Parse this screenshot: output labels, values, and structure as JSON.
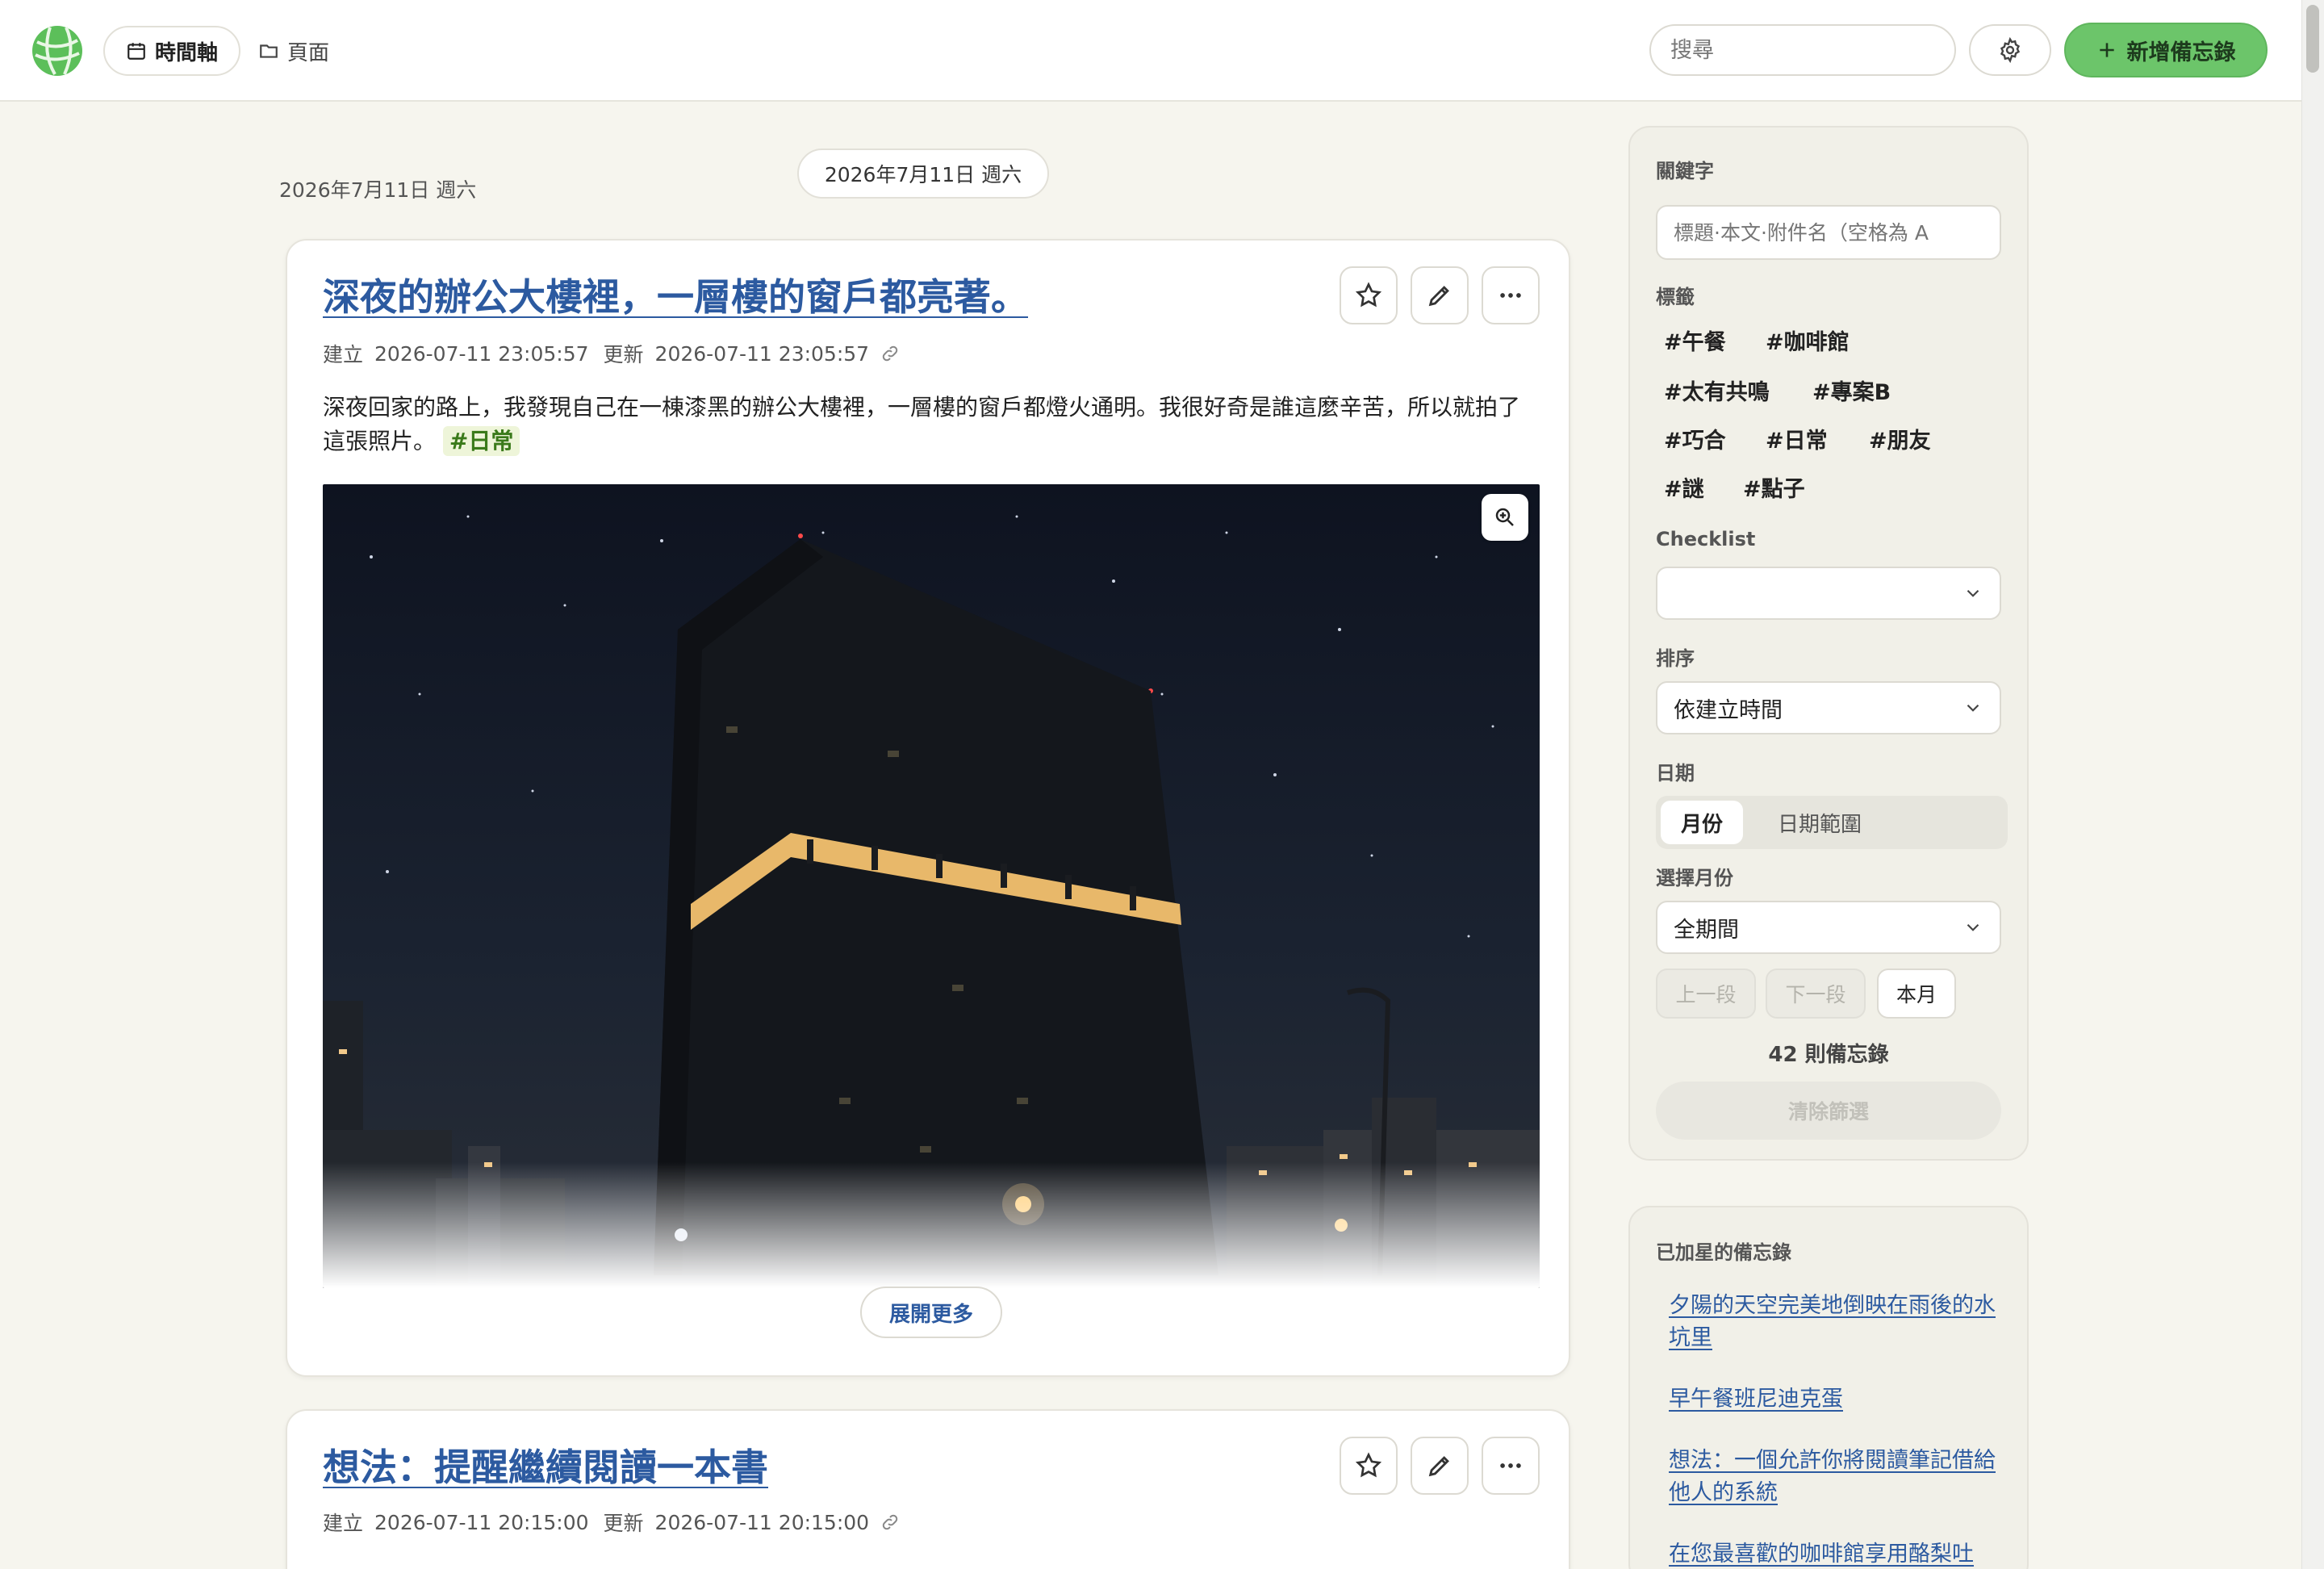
{
  "header": {
    "nav": [
      {
        "label": "時間軸",
        "icon": "calendar-icon"
      },
      {
        "label": "頁面",
        "icon": "folder-icon"
      }
    ],
    "search_placeholder": "搜尋",
    "add_label": "新增備忘錄",
    "accent": "#6cc56a"
  },
  "timeline": {
    "date_label": "2026年7月11日 週六",
    "date_pill": "2026年7月11日 週六",
    "notes": [
      {
        "title": "深夜的辦公大樓裡，一層樓的窗戶都亮著。",
        "created_label": "建立",
        "created": "2026-07-11 23:05:57",
        "updated_label": "更新",
        "updated": "2026-07-11 23:05:57",
        "body": "深夜回家的路上，我發現自己在一棟漆黑的辦公大樓裡，一層樓的窗戶都燈火通明。我很好奇是誰這麼辛苦，所以就拍了這張照片。",
        "tag": "#日常",
        "expand_label": "展開更多"
      },
      {
        "title": "想法：提醒繼續閱讀一本書",
        "created_label": "建立",
        "created": "2026-07-11 20:15:00",
        "updated_label": "更新",
        "updated": "2026-07-11 20:15:00"
      }
    ]
  },
  "sidebar": {
    "keyword_label": "關鍵字",
    "keyword_placeholder": "標題·本文·附件名（空格為 A",
    "tags_label": "標籤",
    "tags": [
      "#午餐",
      "#咖啡館",
      "#太有共鳴",
      "#專案B",
      "#巧合",
      "#日常",
      "#朋友",
      "#謎",
      "#點子"
    ],
    "checklist_label": "Checklist",
    "checklist_value": "",
    "sort_label": "排序",
    "sort_value": "依建立時間",
    "date_label": "日期",
    "date_tabs": [
      "月份",
      "日期範圍"
    ],
    "month_label": "選擇月份",
    "month_value": "全期間",
    "prev_label": "上一段",
    "next_label": "下一段",
    "current_label": "本月",
    "count_text": "42 則備忘錄",
    "clear_label": "清除篩選",
    "starred_label": "已加星的備忘錄",
    "starred": [
      "夕陽的天空完美地倒映在雨後的水坑里",
      "早午餐班尼迪克蛋",
      "想法：一個允許你將閱讀筆記借給他人的系統",
      "在您最喜歡的咖啡館享用酪梨吐"
    ]
  }
}
